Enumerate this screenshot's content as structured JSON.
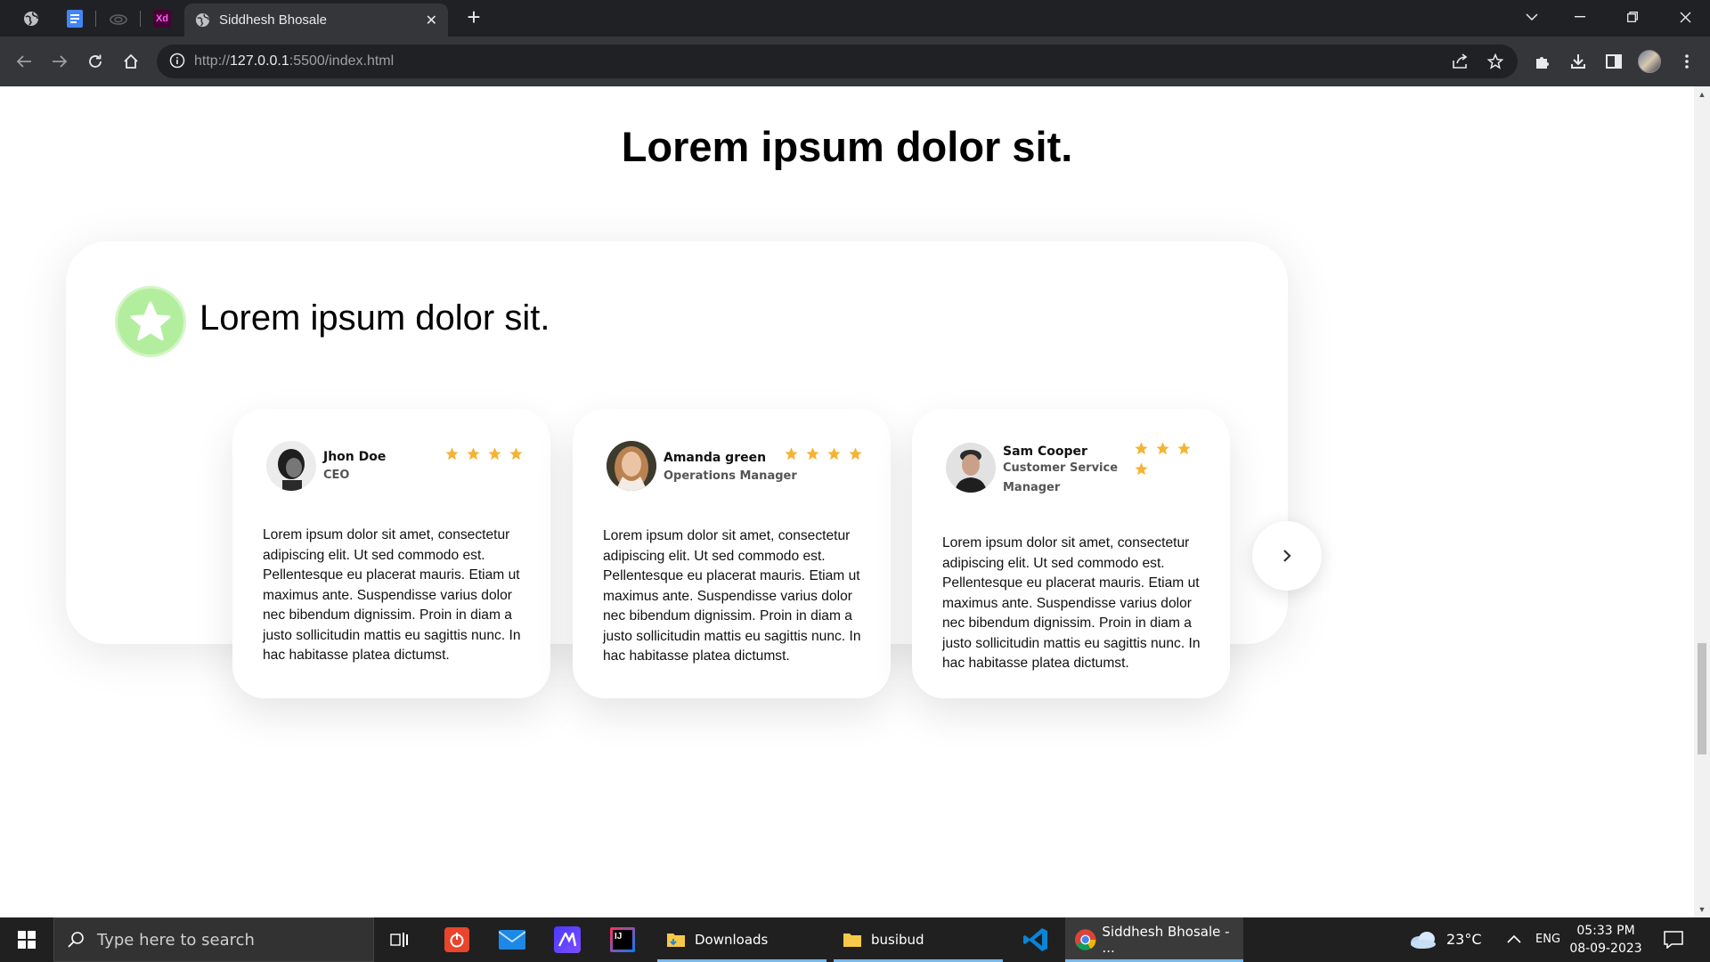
{
  "browser": {
    "pinned_tabs": [
      "globe-icon",
      "docs-icon",
      "cloud-icon",
      "adobe-xd-icon"
    ],
    "pinned_xd_label": "Xd",
    "active_tab": {
      "title": "Siddhesh Bhosale",
      "icon": "globe-icon"
    },
    "newtab_label": "+",
    "url_scheme": "http://",
    "url_host": "127.0.0.1",
    "url_rest": ":5500/index.html"
  },
  "page": {
    "title": "Lorem ipsum dolor sit.",
    "panel": {
      "heading": "Lorem ipsum dolor sit.",
      "badge_icon": "star-badge-icon",
      "badge_color": "#b3ee9e"
    },
    "cards": [
      {
        "name": "Jhon Doe",
        "role_lines": [
          "CEO"
        ],
        "rating": 4,
        "text": "Lorem ipsum dolor sit amet, consectetur adipiscing elit. Ut sed commodo est. Pellentesque eu placerat mauris. Etiam ut maximus ante. Suspendisse varius dolor nec bibendum dignissim. Proin in diam a justo sollicitudin mattis eu sagittis nunc. In hac habitasse platea dictumst."
      },
      {
        "name": "Amanda green",
        "role_lines": [
          "Operations Manager"
        ],
        "rating": 4,
        "text": "Lorem ipsum dolor sit amet, consectetur adipiscing elit. Ut sed commodo est. Pellentesque eu placerat mauris. Etiam ut maximus ante. Suspendisse varius dolor nec bibendum dignissim. Proin in diam a justo sollicitudin mattis eu sagittis nunc. In hac habitasse platea dictumst."
      },
      {
        "name": "Sam Cooper",
        "role_lines": [
          "Customer Service",
          "Manager"
        ],
        "rating": 4,
        "text": "Lorem ipsum dolor sit amet, consectetur adipiscing elit. Ut sed commodo est. Pellentesque eu placerat mauris. Etiam ut maximus ante. Suspendisse varius dolor nec bibendum dignissim. Proin in diam a justo sollicitudin mattis eu sagittis nunc. In hac habitasse platea dictumst."
      }
    ],
    "star_color": "#f5b335",
    "next_icon": "chevron-right-icon"
  },
  "taskbar": {
    "search_placeholder": "Type here to search",
    "apps": [
      {
        "label": "Downloads",
        "icon": "folder-icon"
      },
      {
        "label": "busibud",
        "icon": "folder-icon"
      },
      {
        "label": "Siddhesh Bhosale - ...",
        "icon": "chrome-icon"
      }
    ],
    "weather": "23°C",
    "language": "ENG",
    "time": "05:33 PM",
    "date": "08-09-2023",
    "accent": "#76b9ed"
  }
}
